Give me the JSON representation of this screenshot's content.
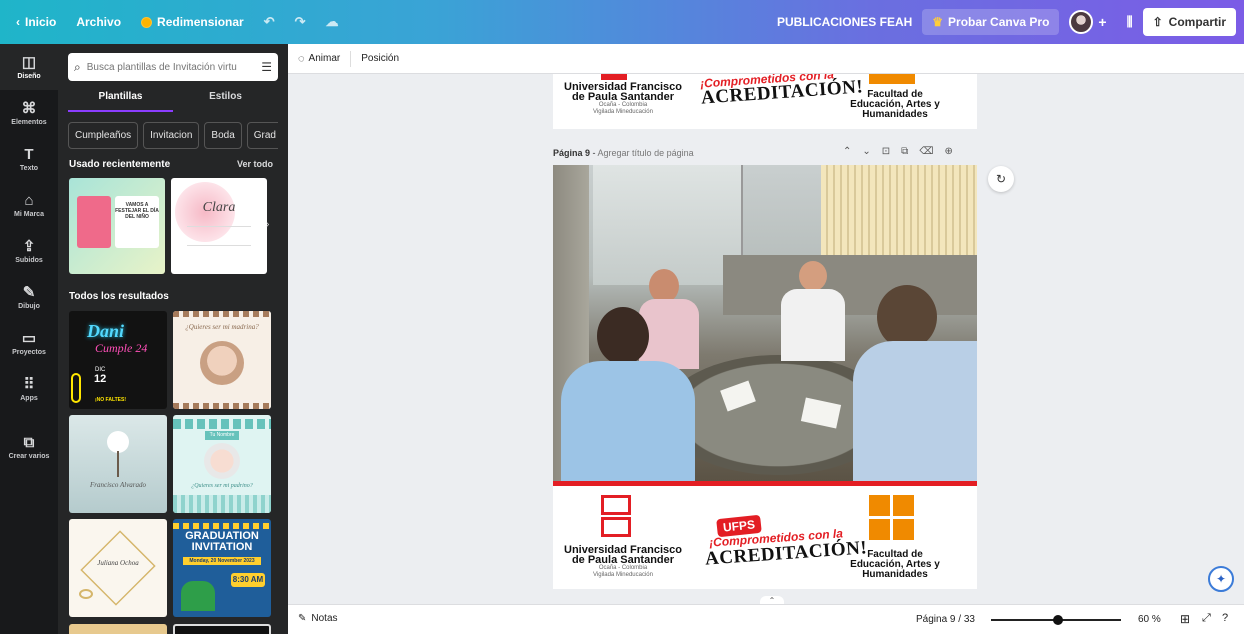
{
  "topbar": {
    "home": "Inicio",
    "file": "Archivo",
    "resize": "Redimensionar",
    "team": "PUBLICACIONES FEAH",
    "pro": "Probar Canva Pro",
    "share": "Compartir"
  },
  "rail": [
    {
      "label": "Diseño",
      "icon": "layout-icon",
      "glyph": "◫"
    },
    {
      "label": "Elementos",
      "icon": "shapes-icon",
      "glyph": "⌘"
    },
    {
      "label": "Texto",
      "icon": "text-icon",
      "glyph": "T"
    },
    {
      "label": "Mi Marca",
      "icon": "brand-icon",
      "glyph": "⌂"
    },
    {
      "label": "Subidos",
      "icon": "upload-icon",
      "glyph": "⇪"
    },
    {
      "label": "Dibujo",
      "icon": "draw-icon",
      "glyph": "✎"
    },
    {
      "label": "Proyectos",
      "icon": "folder-icon",
      "glyph": "▭"
    },
    {
      "label": "Apps",
      "icon": "apps-icon",
      "glyph": "⠿"
    },
    {
      "label": "Crear varios",
      "icon": "create-multiple-icon",
      "glyph": "⧉"
    }
  ],
  "panel": {
    "search_placeholder": "Busca plantillas de Invitación virtu",
    "tabs": [
      "Plantillas",
      "Estilos"
    ],
    "chips": [
      "Cumpleaños",
      "Invitacion",
      "Boda",
      "Grad"
    ],
    "recent_title": "Usado recientemente",
    "see_all": "Ver todo",
    "all_results": "Todos los resultados",
    "recent_thumbs": [
      "VAMOS A FESTEJAR EL DÍA DEL NIÑO",
      "Clara"
    ],
    "result_thumbs": [
      {
        "title": "Dani",
        "subtitle": "Cumple 24",
        "day": "12",
        "month": "DIC",
        "cta": "¡NO FALTES!"
      },
      {
        "title": "¿Quieres ser mi madrina?"
      },
      {
        "title": "Francisco Alvarado"
      },
      {
        "title": "Tu Nombre",
        "subtitle": "¿Quieres ser mi padrino?"
      },
      {
        "title": "Juliana Ochoa"
      },
      {
        "title": "GRADUATION INVITATION",
        "subtitle": "Monday, 20 November 2023",
        "time": "8:30 AM"
      }
    ]
  },
  "editor": {
    "animate": "Animar",
    "position": "Posición",
    "page_label": "Página 9",
    "page_title_placeholder": "Agregar título de página",
    "logos": {
      "university": "Universidad Francisco de Paula Santander",
      "campus": "Ocaña - Colombia",
      "supervision": "Vigilada Mineducación",
      "slogan_top": "¡Comprometidos con la",
      "slogan_main": "ACREDITACIÓN!",
      "brand": "UFPS",
      "faculty": "Facultad de Educación, Artes y Humanidades"
    }
  },
  "bottombar": {
    "notes": "Notas",
    "page_counter": "Página 9 / 33",
    "zoom": "60 %",
    "zoom_fraction": 0.6
  }
}
